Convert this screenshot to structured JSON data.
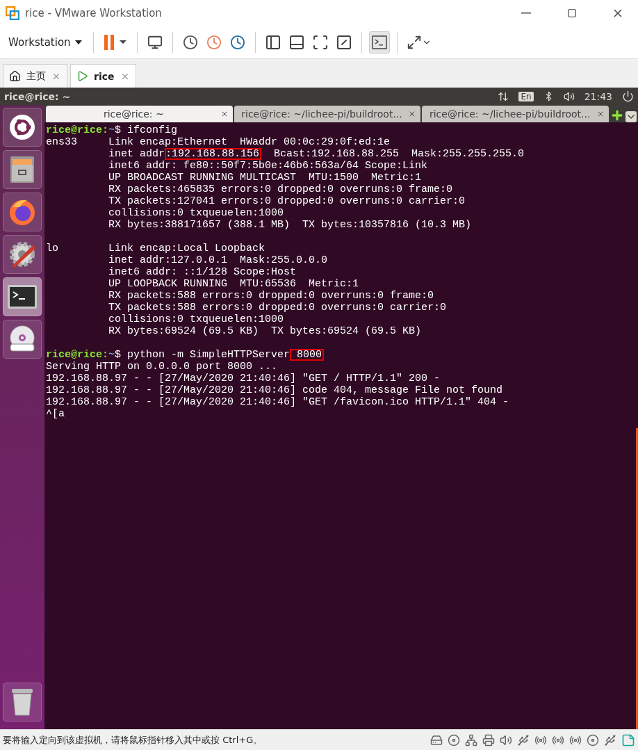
{
  "window": {
    "title": "rice - VMware Workstation"
  },
  "toolbar": {
    "menu": "Workstation"
  },
  "tabs": [
    {
      "label": "主页",
      "kind": "home",
      "selected": false
    },
    {
      "label": "rice",
      "kind": "vm",
      "selected": true
    }
  ],
  "guest_topbar": {
    "title": "rice@rice: ~",
    "keyboard": "En",
    "time": "21:43"
  },
  "launcher": [
    {
      "kind": "ubuntu",
      "selected": false
    },
    {
      "kind": "files",
      "selected": false
    },
    {
      "kind": "browser",
      "selected": false
    },
    {
      "kind": "settings",
      "selected": false
    },
    {
      "kind": "terminal",
      "selected": true
    },
    {
      "kind": "dvd",
      "selected": false
    },
    {
      "kind": "trash",
      "selected": false
    }
  ],
  "terminal_tabs": [
    {
      "label": "rice@rice: ~",
      "selected": true
    },
    {
      "label": "rice@rice: ~/lichee-pi/buildroot...",
      "selected": false
    },
    {
      "label": "rice@rice: ~/lichee-pi/buildroot...",
      "selected": false
    }
  ],
  "terminal_lines": [
    {
      "kind": "text",
      "segments": [
        {
          "kind": "user",
          "text": "rice@rice:"
        },
        {
          "kind": "path",
          "text": "~"
        },
        {
          "kind": "plain",
          "text": "$ ifconfig"
        }
      ]
    },
    {
      "kind": "text",
      "segments": [
        {
          "kind": "plain",
          "text": "ens33     Link encap:Ethernet  HWaddr 00:0c:29:0f:ed:1e"
        }
      ]
    },
    {
      "kind": "text",
      "segments": [
        {
          "kind": "plain",
          "text": "          inet addr"
        },
        {
          "kind": "highlight",
          "text": ":192.168.88.156"
        },
        {
          "kind": "plain",
          "text": "  Bcast:192.168.88.255  Mask:255.255.255.0"
        }
      ]
    },
    {
      "kind": "text",
      "segments": [
        {
          "kind": "plain",
          "text": "          inet6 addr: fe80::50f7:5b0e:46b6:563a/64 Scope:Link"
        }
      ]
    },
    {
      "kind": "text",
      "segments": [
        {
          "kind": "plain",
          "text": "          UP BROADCAST RUNNING MULTICAST  MTU:1500  Metric:1"
        }
      ]
    },
    {
      "kind": "text",
      "segments": [
        {
          "kind": "plain",
          "text": "          RX packets:465835 errors:0 dropped:0 overruns:0 frame:0"
        }
      ]
    },
    {
      "kind": "text",
      "segments": [
        {
          "kind": "plain",
          "text": "          TX packets:127041 errors:0 dropped:0 overruns:0 carrier:0"
        }
      ]
    },
    {
      "kind": "text",
      "segments": [
        {
          "kind": "plain",
          "text": "          collisions:0 txqueuelen:1000"
        }
      ]
    },
    {
      "kind": "text",
      "segments": [
        {
          "kind": "plain",
          "text": "          RX bytes:388171657 (388.1 MB)  TX bytes:10357816 (10.3 MB)"
        }
      ]
    },
    {
      "kind": "blank"
    },
    {
      "kind": "text",
      "segments": [
        {
          "kind": "plain",
          "text": "lo        Link encap:Local Loopback"
        }
      ]
    },
    {
      "kind": "text",
      "segments": [
        {
          "kind": "plain",
          "text": "          inet addr:127.0.0.1  Mask:255.0.0.0"
        }
      ]
    },
    {
      "kind": "text",
      "segments": [
        {
          "kind": "plain",
          "text": "          inet6 addr: ::1/128 Scope:Host"
        }
      ]
    },
    {
      "kind": "text",
      "segments": [
        {
          "kind": "plain",
          "text": "          UP LOOPBACK RUNNING  MTU:65536  Metric:1"
        }
      ]
    },
    {
      "kind": "text",
      "segments": [
        {
          "kind": "plain",
          "text": "          RX packets:588 errors:0 dropped:0 overruns:0 frame:0"
        }
      ]
    },
    {
      "kind": "text",
      "segments": [
        {
          "kind": "plain",
          "text": "          TX packets:588 errors:0 dropped:0 overruns:0 carrier:0"
        }
      ]
    },
    {
      "kind": "text",
      "segments": [
        {
          "kind": "plain",
          "text": "          collisions:0 txqueuelen:1000"
        }
      ]
    },
    {
      "kind": "text",
      "segments": [
        {
          "kind": "plain",
          "text": "          RX bytes:69524 (69.5 KB)  TX bytes:69524 (69.5 KB)"
        }
      ]
    },
    {
      "kind": "blank"
    },
    {
      "kind": "text",
      "segments": [
        {
          "kind": "user",
          "text": "rice@rice:"
        },
        {
          "kind": "path",
          "text": "~"
        },
        {
          "kind": "plain",
          "text": "$ python -m SimpleHTTPServer"
        },
        {
          "kind": "highlight",
          "text": " 8000"
        }
      ]
    },
    {
      "kind": "text",
      "segments": [
        {
          "kind": "plain",
          "text": "Serving HTTP on 0.0.0.0 port 8000 ..."
        }
      ]
    },
    {
      "kind": "text",
      "segments": [
        {
          "kind": "plain",
          "text": "192.168.88.97 - - [27/May/2020 21:40:46] \"GET / HTTP/1.1\" 200 -"
        }
      ]
    },
    {
      "kind": "text",
      "segments": [
        {
          "kind": "plain",
          "text": "192.168.88.97 - - [27/May/2020 21:40:46] code 404, message File not found"
        }
      ]
    },
    {
      "kind": "text",
      "segments": [
        {
          "kind": "plain",
          "text": "192.168.88.97 - - [27/May/2020 21:40:46] \"GET /favicon.ico HTTP/1.1\" 404 -"
        }
      ]
    },
    {
      "kind": "text",
      "segments": [
        {
          "kind": "plain",
          "text": "^[a"
        }
      ]
    }
  ],
  "status_bar": {
    "message": "要将输入定向到该虚拟机，请将鼠标指针移入其中或按 Ctrl+G。"
  }
}
